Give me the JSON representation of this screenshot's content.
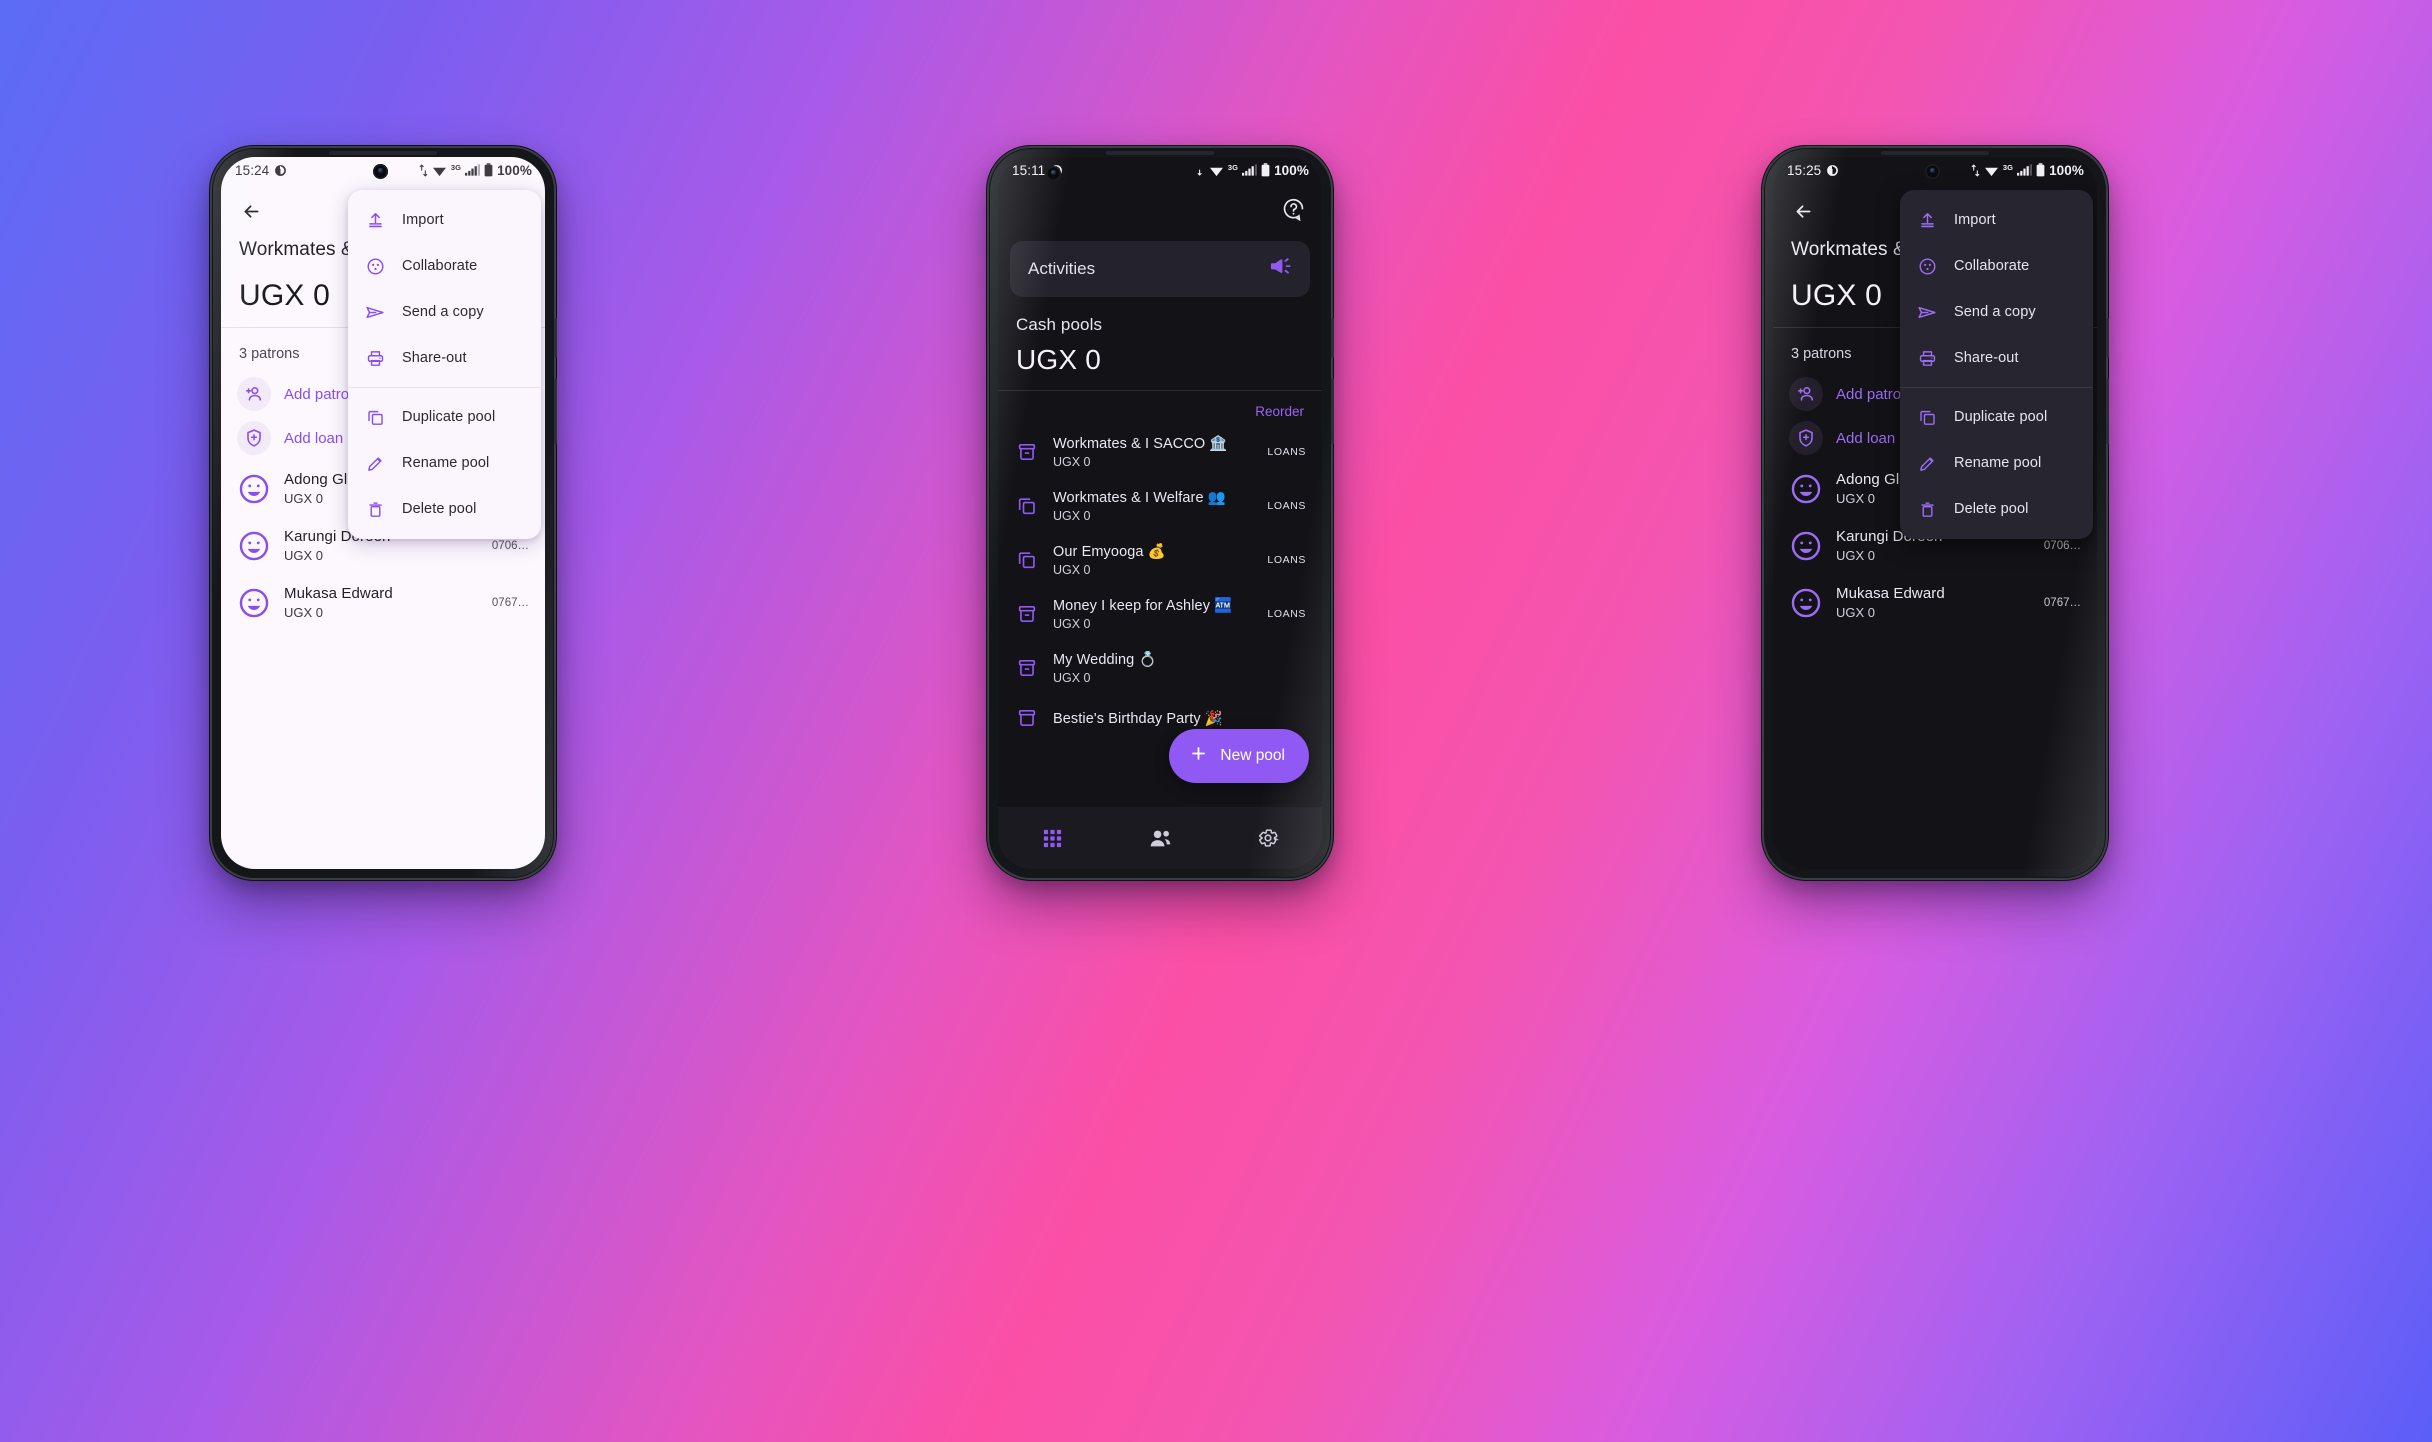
{
  "background": {
    "gradient_from": "#5b6cf5",
    "gradient_to": "#fb4fa5"
  },
  "theme": {
    "accent": "#8a4df0",
    "accent_dark": "#9c6cf5",
    "fab": "#9059f4"
  },
  "menu": {
    "groups": [
      [
        {
          "icon": "import-icon",
          "label": "Import"
        },
        {
          "icon": "collaborate-icon",
          "label": "Collaborate"
        },
        {
          "icon": "send-icon",
          "label": "Send a copy"
        },
        {
          "icon": "print-icon",
          "label": "Share-out"
        }
      ],
      [
        {
          "icon": "duplicate-icon",
          "label": "Duplicate pool"
        },
        {
          "icon": "pencil-icon",
          "label": "Rename pool"
        },
        {
          "icon": "trash-icon",
          "label": "Delete pool"
        }
      ]
    ]
  },
  "phone1": {
    "theme": "light",
    "status": {
      "time": "15:24",
      "network": "3G",
      "battery": "100%"
    },
    "back_icon": "back-arrow-icon",
    "pool": {
      "name": "Workmates & I",
      "amount": "UGX 0"
    },
    "patron_count": "3 patrons",
    "actions": [
      {
        "icon": "add-person-icon",
        "label": "Add patron"
      },
      {
        "icon": "shield-plus-icon",
        "label": "Add loan"
      }
    ],
    "patrons": [
      {
        "name": "Adong Gloria",
        "amount": "UGX 0",
        "phone": ""
      },
      {
        "name": "Karungi Doreen",
        "amount": "UGX 0",
        "phone": "0706…"
      },
      {
        "name": "Mukasa Edward",
        "amount": "UGX 0",
        "phone": "0767…"
      }
    ]
  },
  "phone2": {
    "theme": "dark",
    "status": {
      "time": "15:11",
      "network": "3G",
      "battery": "100%"
    },
    "help_icon": "help-circle-icon",
    "activities": {
      "title": "Activities",
      "icon": "megaphone-icon"
    },
    "cash": {
      "label": "Cash pools",
      "amount": "UGX 0"
    },
    "reorder_label": "Reorder",
    "pools": [
      {
        "icon": "archive-icon",
        "name": "Workmates & I SACCO 🏦",
        "amount": "UGX 0",
        "tag": "LOANS"
      },
      {
        "icon": "duplicate-icon",
        "name": "Workmates & I Welfare 👥",
        "amount": "UGX 0",
        "tag": "LOANS"
      },
      {
        "icon": "duplicate-icon",
        "name": "Our Emyooga 💰",
        "amount": "UGX 0",
        "tag": "LOANS"
      },
      {
        "icon": "archive-icon",
        "name": "Money I keep for Ashley 🏧",
        "amount": "UGX 0",
        "tag": "LOANS"
      },
      {
        "icon": "archive-icon",
        "name": "My Wedding 💍",
        "amount": "UGX 0",
        "tag": ""
      },
      {
        "icon": "archive-icon",
        "name": "Bestie's Birthday Party 🎉",
        "amount": "",
        "tag": ""
      }
    ],
    "fab": {
      "icon": "plus-icon",
      "label": "New pool"
    },
    "nav": [
      {
        "icon": "grid-icon",
        "active": true
      },
      {
        "icon": "people-icon",
        "active": false
      },
      {
        "icon": "gear-icon",
        "active": false
      }
    ]
  },
  "phone3": {
    "theme": "dark",
    "status": {
      "time": "15:25",
      "network": "3G",
      "battery": "100%"
    },
    "back_icon": "back-arrow-icon",
    "pool": {
      "name": "Workmates & I",
      "amount": "UGX 0"
    },
    "patron_count": "3 patrons",
    "actions": [
      {
        "icon": "add-person-icon",
        "label": "Add patron"
      },
      {
        "icon": "shield-plus-icon",
        "label": "Add loan"
      }
    ],
    "patrons": [
      {
        "name": "Adong Gloria",
        "amount": "UGX 0",
        "phone": ""
      },
      {
        "name": "Karungi Doreen",
        "amount": "UGX 0",
        "phone": "0706…"
      },
      {
        "name": "Mukasa Edward",
        "amount": "UGX 0",
        "phone": "0767…"
      }
    ]
  }
}
